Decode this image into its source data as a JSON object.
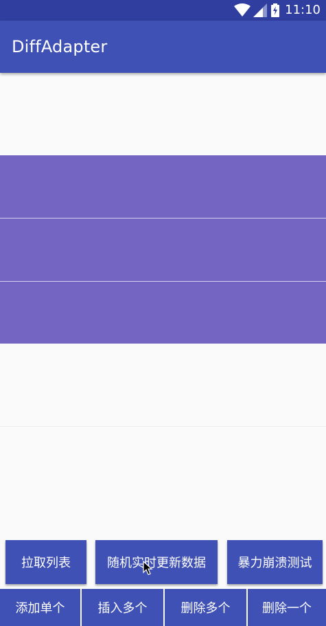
{
  "status_bar": {
    "time": "11:10",
    "icons": [
      "wifi-icon",
      "cell-signal-icon",
      "battery-charging-icon"
    ]
  },
  "app_bar": {
    "title": "DiffAdapter",
    "color": "#3f51b5"
  },
  "list": {
    "item_colors": {
      "blank": "#fafafa",
      "highlighted": "#7565c2"
    },
    "items": [
      {
        "style": "blank"
      },
      {
        "style": "highlighted"
      },
      {
        "style": "highlighted"
      },
      {
        "style": "highlighted"
      },
      {
        "style": "blank"
      },
      {
        "style": "blank"
      }
    ]
  },
  "buttons": {
    "row1": [
      "拉取列表",
      "随机实时更新数据",
      "暴力崩溃测试"
    ],
    "row2": [
      "添加单个",
      "插入多个",
      "删除多个",
      "删除一个"
    ]
  }
}
